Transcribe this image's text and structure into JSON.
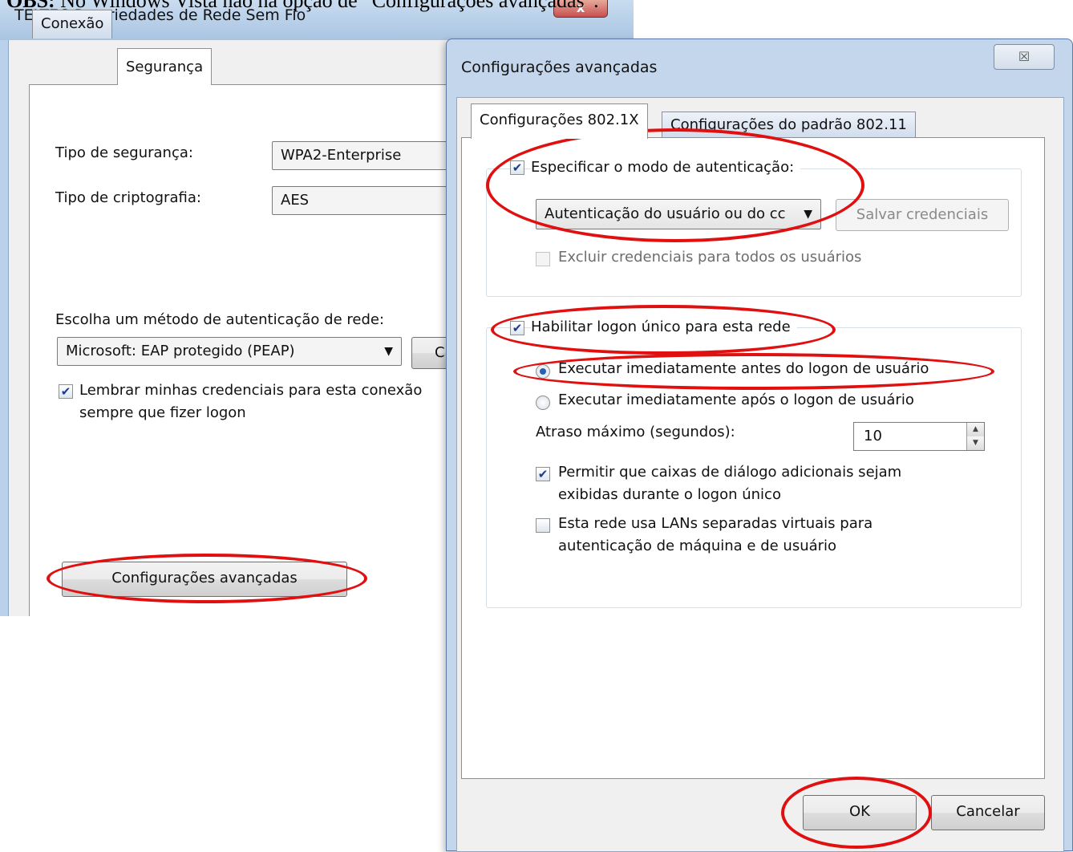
{
  "caption": {
    "prefix": "OBS:",
    "text": " No Windows Vista não há opção de “Configurações avançadas”."
  },
  "background_window": {
    "title": "TELTEC Propriedades de Rede Sem Fio",
    "close_glyph": "x",
    "tabs": [
      "Conexão",
      "Segurança"
    ],
    "security_type_label": "Tipo de segurança:",
    "security_type_value": "WPA2-Enterprise",
    "encryption_type_label": "Tipo de criptografia:",
    "encryption_type_value": "AES",
    "auth_method_label": "Escolha um método de autenticação de rede:",
    "auth_method_value": "Microsoft: EAP protegido (PEAP)",
    "settings_button_partial": "C",
    "remember_credentials_label_1": "Lembrar minhas credenciais para esta conexão",
    "remember_credentials_label_2": "sempre que fizer logon",
    "advanced_settings_button": "Configurações avançadas"
  },
  "dialog": {
    "title": "Configurações avançadas",
    "close_glyph": "☒",
    "tabs": [
      "Configurações 802.1X",
      "Configurações do padrão 802.11"
    ],
    "specify_auth_mode_label": "Especificar o modo de autenticação:",
    "auth_mode_value": "Autenticação do usuário ou do cc",
    "save_credentials_button": "Salvar credenciais",
    "delete_credentials_label": "Excluir credenciais para todos os usuários",
    "enable_sso_label": "Habilitar logon único para esta rede",
    "run_before_logon_label": "Executar imediatamente antes do logon de usuário",
    "run_after_logon_label": "Executar imediatamente após o logon de usuário",
    "max_delay_label": "Atraso máximo (segundos):",
    "max_delay_value": "10",
    "allow_dialogs_label_1": "Permitir que caixas de diálogo adicionais sejam",
    "allow_dialogs_label_2": "exibidas durante o logon único",
    "vlan_label_1": "Esta rede usa LANs separadas virtuais para",
    "vlan_label_2": "autenticação de máquina e de usuário",
    "ok_button": "OK",
    "cancel_button": "Cancelar",
    "specify_auth_mode_checked": true,
    "delete_credentials_checked": false,
    "enable_sso_checked": true,
    "run_before_logon_selected": true,
    "allow_dialogs_checked": true,
    "vlan_checked": false
  },
  "colors": {
    "annotation": "#e01010",
    "window_frame": "#c3d6ec",
    "panel": "#ffffff"
  }
}
